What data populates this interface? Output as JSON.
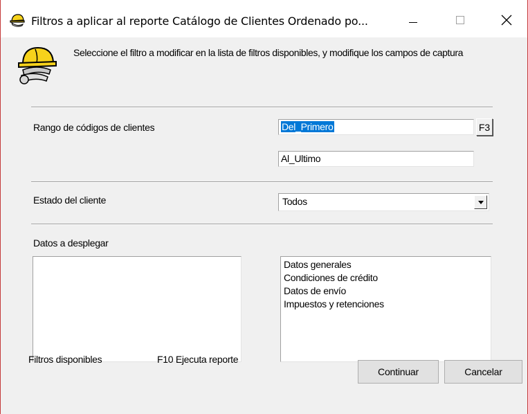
{
  "window": {
    "title": "Filtros a aplicar al reporte Catálogo de Clientes Ordenado po...",
    "controls": {
      "minimize": "—",
      "maximize": "☐",
      "close": "✕"
    },
    "icon": "hardhat-icon"
  },
  "header": {
    "instructions": "Seleccione el filtro a modificar  en la lista de filtros disponibles, y modifique los campos de  captura"
  },
  "filters": {
    "codes_label": "Rango de códigos de clientes",
    "from_value": "Del_Primero",
    "f3_label": "F3",
    "to_value": "Al_Ultimo",
    "status_label": "Estado del cliente",
    "status_value": "Todos",
    "display_label": "Datos a desplegar",
    "available_items": [],
    "selected_items": [
      "Datos generales",
      "Condiciones de crédito",
      "Datos de envío",
      "Impuestos y retenciones"
    ],
    "move_buttons": {
      "add": ">",
      "add_all": ">>",
      "remove_all": "<<",
      "remove": "<"
    }
  },
  "footer": {
    "available_label": "Filtros disponibles",
    "hint": "F10 Ejecuta reporte",
    "continue_label": "Continuar",
    "cancel_label": "Cancelar"
  },
  "colors": {
    "selection": "#0078d7",
    "window_border": "#c43a3a",
    "face": "#f0f0f0"
  }
}
